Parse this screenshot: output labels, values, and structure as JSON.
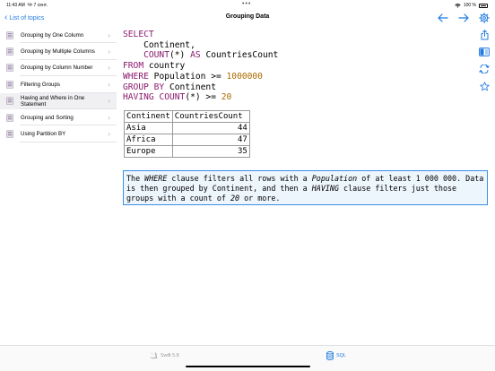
{
  "status": {
    "time": "11:43 AM",
    "date": "Чт 7 сент.",
    "battery": "100 %"
  },
  "nav": {
    "back_label": "List of topics",
    "title": "Grouping Data"
  },
  "sidebar": {
    "items": [
      {
        "label": "Grouping by One Column"
      },
      {
        "label": "Grouping by Multiple Columns"
      },
      {
        "label": "Grouping by Column Number"
      },
      {
        "label": "Filtering Groups"
      },
      {
        "label": "Having and Where in One Statement",
        "selected": true
      },
      {
        "label": "Grouping and Sorting"
      },
      {
        "label": "Using Partition BY"
      }
    ]
  },
  "code": {
    "l1_kw": "SELECT",
    "l2": "    Continent,",
    "l3_pre": "    ",
    "l3_kw1": "COUNT",
    "l3_mid": "(*) ",
    "l3_kw2": "AS",
    "l3_post": " CountriesCount",
    "l4_kw": "FROM",
    "l4_post": " country",
    "l5_kw": "WHERE",
    "l5_mid": " Population >= ",
    "l5_num": "1000000",
    "l6_kw": "GROUP BY",
    "l6_post": " Continent",
    "l7_kw": "HAVING",
    "l7_kw2": "COUNT",
    "l7_mid": "(*) >= ",
    "l7_num": "20"
  },
  "result": {
    "columns": [
      "Continent",
      "CountriesCount"
    ],
    "rows": [
      [
        "Asia",
        "44"
      ],
      [
        "Africa",
        "47"
      ],
      [
        "Europe",
        "35"
      ]
    ]
  },
  "note": {
    "t1": "The ",
    "e1": "WHERE",
    "t2": " clause filters all rows with a ",
    "e2": "Population",
    "t3": " of at least 1 000 000. Data is then grouped by Continent, and then a ",
    "e3": "HAVING",
    "t4": " clause filters just those groups with a count of ",
    "e4": "20",
    "t5": " or more."
  },
  "tabs": {
    "swift": "Swift 5.8",
    "sql": "SQL"
  },
  "colors": {
    "accent": "#1f7ae0",
    "keyword": "#8b1a6d",
    "number": "#a86a00",
    "note_bg": "#edf5fd",
    "note_border": "#3b8fe4"
  }
}
